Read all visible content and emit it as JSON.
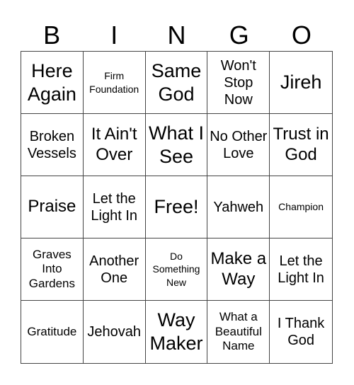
{
  "header": [
    "B",
    "I",
    "N",
    "G",
    "O"
  ],
  "cells": [
    {
      "text": "Here Again",
      "size": "xl"
    },
    {
      "text": "Firm Foundation",
      "size": "xs"
    },
    {
      "text": "Same God",
      "size": "xl"
    },
    {
      "text": "Won't Stop Now",
      "size": "m"
    },
    {
      "text": "Jireh",
      "size": "xl"
    },
    {
      "text": "Broken Vessels",
      "size": "m"
    },
    {
      "text": "It Ain't Over",
      "size": "l"
    },
    {
      "text": "What I See",
      "size": "xl"
    },
    {
      "text": "No Other Love",
      "size": "m"
    },
    {
      "text": "Trust in God",
      "size": "l"
    },
    {
      "text": "Praise",
      "size": "l"
    },
    {
      "text": "Let the Light In",
      "size": "m"
    },
    {
      "text": "Free!",
      "size": "xl"
    },
    {
      "text": "Yahweh",
      "size": "m"
    },
    {
      "text": "Champion",
      "size": "xs"
    },
    {
      "text": "Graves Into Gardens",
      "size": "s"
    },
    {
      "text": "Another One",
      "size": "m"
    },
    {
      "text": "Do Something New",
      "size": "xs"
    },
    {
      "text": "Make a Way",
      "size": "l"
    },
    {
      "text": "Let the Light In",
      "size": "m"
    },
    {
      "text": "Gratitude",
      "size": "s"
    },
    {
      "text": "Jehovah",
      "size": "m"
    },
    {
      "text": "Way Maker",
      "size": "xl"
    },
    {
      "text": "What a Beautiful Name",
      "size": "s"
    },
    {
      "text": "I Thank God",
      "size": "m"
    }
  ]
}
